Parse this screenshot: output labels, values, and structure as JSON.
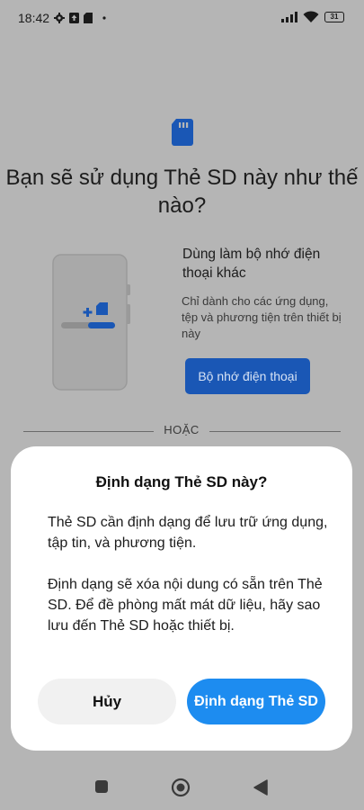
{
  "status_bar": {
    "time": "18:42",
    "battery": "31",
    "icons": [
      "gear-icon",
      "upload-box-icon",
      "sd-card-icon",
      "dot-icon",
      "signal-icon",
      "wifi-icon",
      "battery-icon"
    ]
  },
  "background": {
    "title": "Bạn sẽ sử dụng Thẻ SD này như thế nào?",
    "option": {
      "title": "Dùng làm bộ nhớ điện thoại khác",
      "description": "Chỉ dành cho các ứng dụng, tệp và phương tiện trên thiết bị này",
      "button": "Bộ nhớ điện thoại"
    },
    "divider_label": "HOẶC",
    "colors": {
      "accent": "#1a57b5",
      "overlay": "#b5b5b5"
    }
  },
  "dialog": {
    "title": "Định dạng Thẻ SD này?",
    "paragraph1": "Thẻ SD cần định dạng để lưu trữ ứng dụng, tập tin, và phương tiện.",
    "paragraph2": "Định dạng sẽ xóa nội dung có sẵn trên Thẻ SD. Để đề phòng mất mát dữ liệu, hãy sao lưu đến Thẻ SD hoặc thiết bị.",
    "cancel_label": "Hủy",
    "confirm_label": "Định dạng Thẻ SD",
    "colors": {
      "confirm": "#1d8cf0",
      "cancel": "#f1f1f1"
    }
  },
  "navbar": {
    "icons": [
      "recents-icon",
      "home-icon",
      "back-icon"
    ]
  }
}
